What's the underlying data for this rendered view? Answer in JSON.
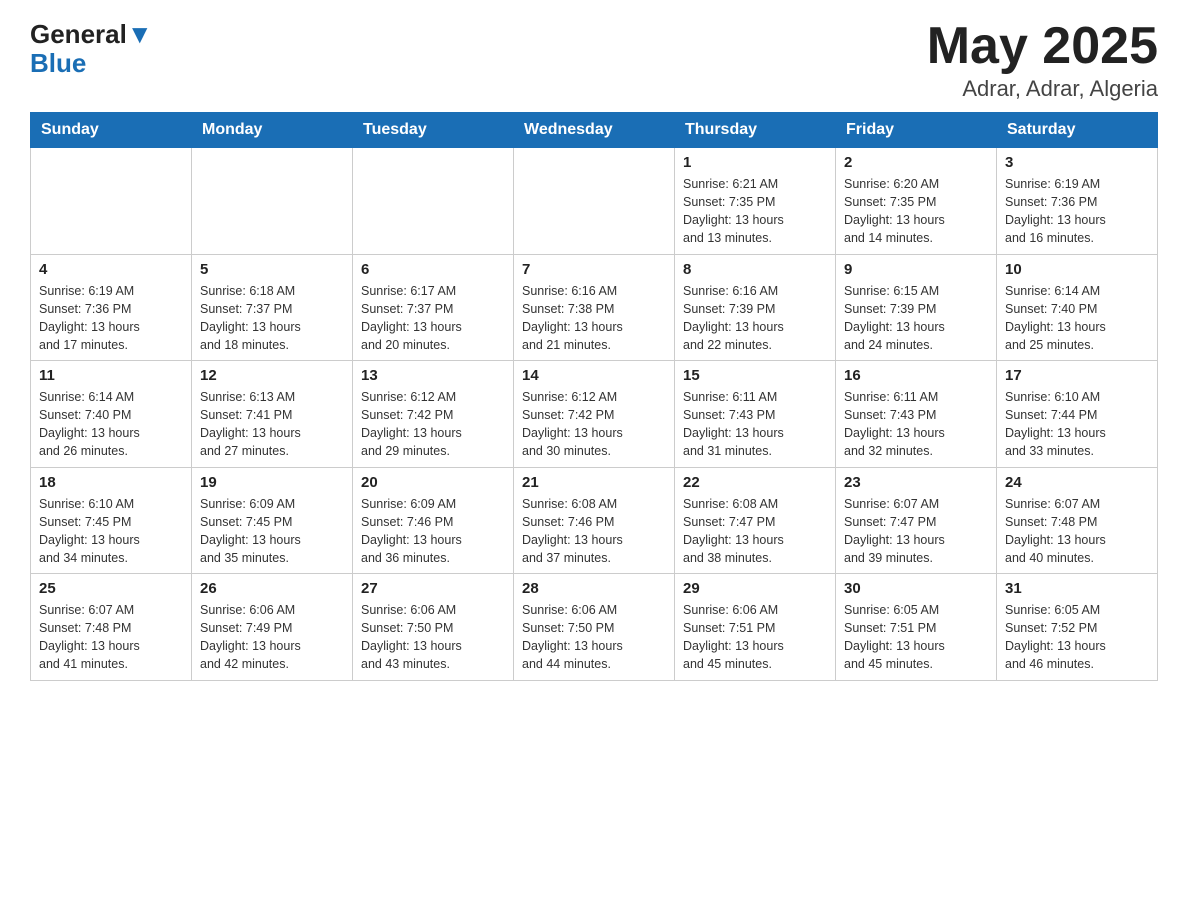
{
  "header": {
    "logo_general": "General",
    "logo_blue": "Blue",
    "month_year": "May 2025",
    "location": "Adrar, Adrar, Algeria"
  },
  "weekdays": [
    "Sunday",
    "Monday",
    "Tuesday",
    "Wednesday",
    "Thursday",
    "Friday",
    "Saturday"
  ],
  "weeks": [
    [
      {
        "day": "",
        "info": ""
      },
      {
        "day": "",
        "info": ""
      },
      {
        "day": "",
        "info": ""
      },
      {
        "day": "",
        "info": ""
      },
      {
        "day": "1",
        "info": "Sunrise: 6:21 AM\nSunset: 7:35 PM\nDaylight: 13 hours\nand 13 minutes."
      },
      {
        "day": "2",
        "info": "Sunrise: 6:20 AM\nSunset: 7:35 PM\nDaylight: 13 hours\nand 14 minutes."
      },
      {
        "day": "3",
        "info": "Sunrise: 6:19 AM\nSunset: 7:36 PM\nDaylight: 13 hours\nand 16 minutes."
      }
    ],
    [
      {
        "day": "4",
        "info": "Sunrise: 6:19 AM\nSunset: 7:36 PM\nDaylight: 13 hours\nand 17 minutes."
      },
      {
        "day": "5",
        "info": "Sunrise: 6:18 AM\nSunset: 7:37 PM\nDaylight: 13 hours\nand 18 minutes."
      },
      {
        "day": "6",
        "info": "Sunrise: 6:17 AM\nSunset: 7:37 PM\nDaylight: 13 hours\nand 20 minutes."
      },
      {
        "day": "7",
        "info": "Sunrise: 6:16 AM\nSunset: 7:38 PM\nDaylight: 13 hours\nand 21 minutes."
      },
      {
        "day": "8",
        "info": "Sunrise: 6:16 AM\nSunset: 7:39 PM\nDaylight: 13 hours\nand 22 minutes."
      },
      {
        "day": "9",
        "info": "Sunrise: 6:15 AM\nSunset: 7:39 PM\nDaylight: 13 hours\nand 24 minutes."
      },
      {
        "day": "10",
        "info": "Sunrise: 6:14 AM\nSunset: 7:40 PM\nDaylight: 13 hours\nand 25 minutes."
      }
    ],
    [
      {
        "day": "11",
        "info": "Sunrise: 6:14 AM\nSunset: 7:40 PM\nDaylight: 13 hours\nand 26 minutes."
      },
      {
        "day": "12",
        "info": "Sunrise: 6:13 AM\nSunset: 7:41 PM\nDaylight: 13 hours\nand 27 minutes."
      },
      {
        "day": "13",
        "info": "Sunrise: 6:12 AM\nSunset: 7:42 PM\nDaylight: 13 hours\nand 29 minutes."
      },
      {
        "day": "14",
        "info": "Sunrise: 6:12 AM\nSunset: 7:42 PM\nDaylight: 13 hours\nand 30 minutes."
      },
      {
        "day": "15",
        "info": "Sunrise: 6:11 AM\nSunset: 7:43 PM\nDaylight: 13 hours\nand 31 minutes."
      },
      {
        "day": "16",
        "info": "Sunrise: 6:11 AM\nSunset: 7:43 PM\nDaylight: 13 hours\nand 32 minutes."
      },
      {
        "day": "17",
        "info": "Sunrise: 6:10 AM\nSunset: 7:44 PM\nDaylight: 13 hours\nand 33 minutes."
      }
    ],
    [
      {
        "day": "18",
        "info": "Sunrise: 6:10 AM\nSunset: 7:45 PM\nDaylight: 13 hours\nand 34 minutes."
      },
      {
        "day": "19",
        "info": "Sunrise: 6:09 AM\nSunset: 7:45 PM\nDaylight: 13 hours\nand 35 minutes."
      },
      {
        "day": "20",
        "info": "Sunrise: 6:09 AM\nSunset: 7:46 PM\nDaylight: 13 hours\nand 36 minutes."
      },
      {
        "day": "21",
        "info": "Sunrise: 6:08 AM\nSunset: 7:46 PM\nDaylight: 13 hours\nand 37 minutes."
      },
      {
        "day": "22",
        "info": "Sunrise: 6:08 AM\nSunset: 7:47 PM\nDaylight: 13 hours\nand 38 minutes."
      },
      {
        "day": "23",
        "info": "Sunrise: 6:07 AM\nSunset: 7:47 PM\nDaylight: 13 hours\nand 39 minutes."
      },
      {
        "day": "24",
        "info": "Sunrise: 6:07 AM\nSunset: 7:48 PM\nDaylight: 13 hours\nand 40 minutes."
      }
    ],
    [
      {
        "day": "25",
        "info": "Sunrise: 6:07 AM\nSunset: 7:48 PM\nDaylight: 13 hours\nand 41 minutes."
      },
      {
        "day": "26",
        "info": "Sunrise: 6:06 AM\nSunset: 7:49 PM\nDaylight: 13 hours\nand 42 minutes."
      },
      {
        "day": "27",
        "info": "Sunrise: 6:06 AM\nSunset: 7:50 PM\nDaylight: 13 hours\nand 43 minutes."
      },
      {
        "day": "28",
        "info": "Sunrise: 6:06 AM\nSunset: 7:50 PM\nDaylight: 13 hours\nand 44 minutes."
      },
      {
        "day": "29",
        "info": "Sunrise: 6:06 AM\nSunset: 7:51 PM\nDaylight: 13 hours\nand 45 minutes."
      },
      {
        "day": "30",
        "info": "Sunrise: 6:05 AM\nSunset: 7:51 PM\nDaylight: 13 hours\nand 45 minutes."
      },
      {
        "day": "31",
        "info": "Sunrise: 6:05 AM\nSunset: 7:52 PM\nDaylight: 13 hours\nand 46 minutes."
      }
    ]
  ]
}
